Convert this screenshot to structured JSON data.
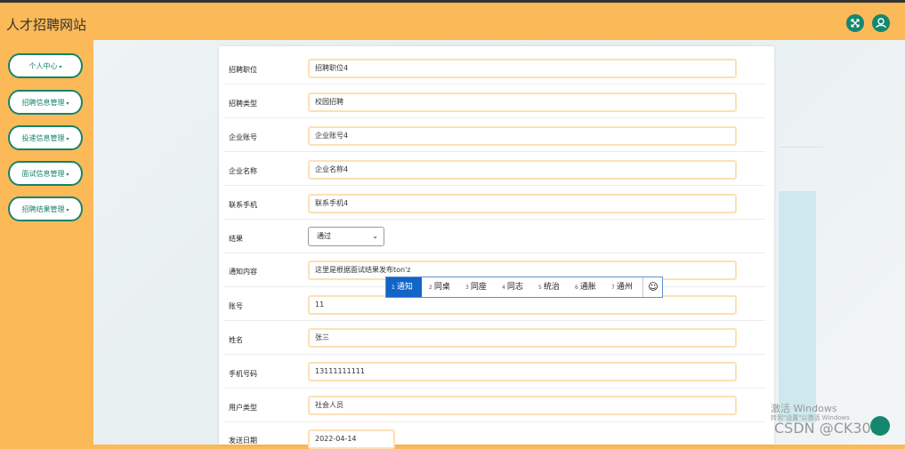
{
  "header": {
    "title": "人才招聘网站",
    "fullscreen_icon": "fullscreen-icon",
    "user_icon": "user-icon"
  },
  "sidebar": {
    "items": [
      {
        "label": "个人中心"
      },
      {
        "label": "招聘信息管理"
      },
      {
        "label": "投递信息管理"
      },
      {
        "label": "面试信息管理"
      },
      {
        "label": "招聘结果管理"
      }
    ],
    "caret": "▾"
  },
  "form": {
    "rows": [
      {
        "label": "招聘职位",
        "value": "招聘职位4"
      },
      {
        "label": "招聘类型",
        "value": "校园招聘"
      },
      {
        "label": "企业账号",
        "value": "企业账号4"
      },
      {
        "label": "企业名称",
        "value": "企业名称4"
      },
      {
        "label": "联系手机",
        "value": "联系手机4"
      },
      {
        "label": "结果",
        "value": "通过"
      },
      {
        "label": "通知内容",
        "value": "这里是根据面试结果发布ton'z"
      },
      {
        "label": "账号",
        "value": "11"
      },
      {
        "label": "姓名",
        "value": "张三"
      },
      {
        "label": "手机号码",
        "value": "13111111111"
      },
      {
        "label": "用户类型",
        "value": "社会人员"
      },
      {
        "label": "发送日期",
        "value": "2022-04-14"
      }
    ]
  },
  "ime": {
    "candidates": [
      {
        "num": "1",
        "text": "通知"
      },
      {
        "num": "2",
        "text": "同桌"
      },
      {
        "num": "3",
        "text": "同座"
      },
      {
        "num": "4",
        "text": "同志"
      },
      {
        "num": "5",
        "text": "统治"
      },
      {
        "num": "6",
        "text": "通胀"
      },
      {
        "num": "7",
        "text": "通州"
      }
    ],
    "emoji": "☺"
  },
  "watermark": {
    "activate_title": "激活 Windows",
    "activate_sub": "转到\"设置\"以激活 Windows",
    "csdn": "CSDN @CK3034"
  },
  "colors": {
    "accent": "#fbb957",
    "green": "#17836b",
    "ime_selected": "#1264c6"
  }
}
